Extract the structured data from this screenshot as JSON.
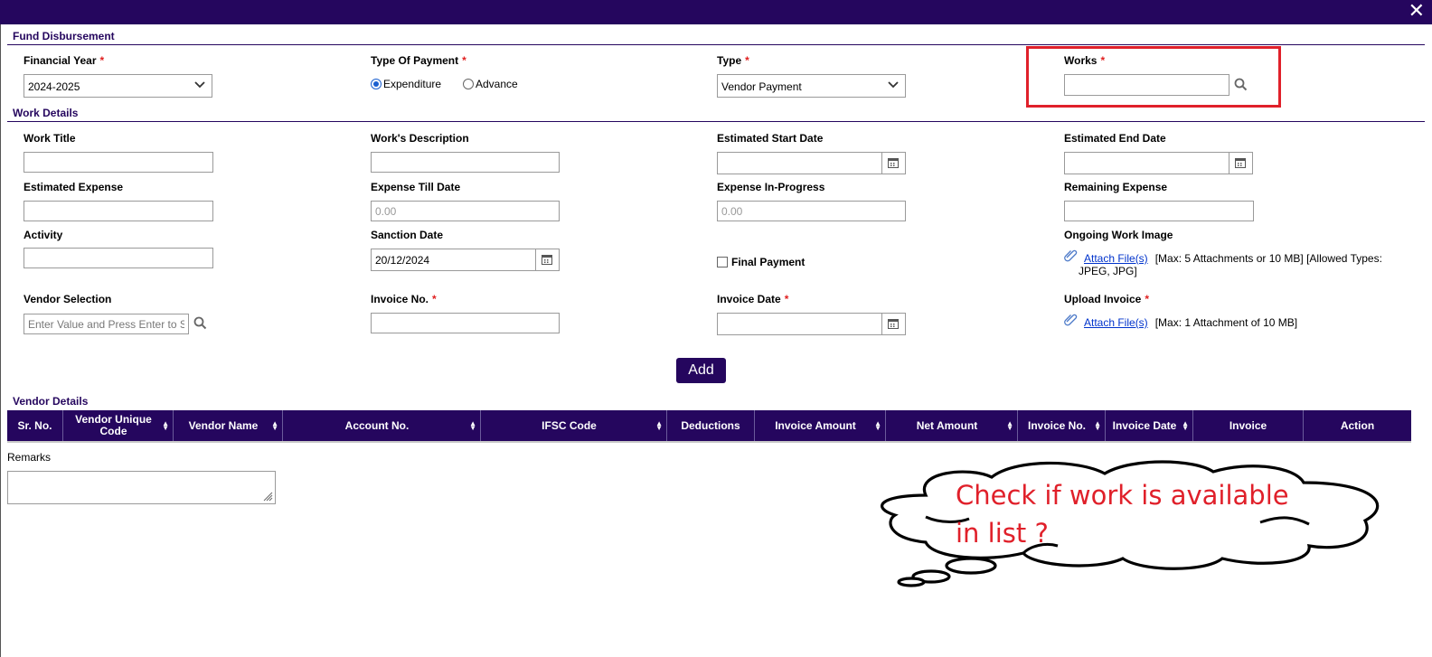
{
  "window": {
    "close_glyph": "✕"
  },
  "sections": {
    "fund": "Fund Disbursement",
    "work": "Work Details",
    "vendor": "Vendor Details"
  },
  "fund": {
    "financial_year_label": "Financial Year",
    "financial_year_value": "2024-2025",
    "type_of_payment_label": "Type Of Payment",
    "payment_options": [
      "Expenditure",
      "Advance"
    ],
    "payment_selected": "Expenditure",
    "type_label": "Type",
    "type_value": "Vendor Payment",
    "works_label": "Works",
    "works_value": ""
  },
  "work": {
    "work_title_label": "Work Title",
    "work_description_label": "Work's Description",
    "est_start_label": "Estimated Start Date",
    "est_end_label": "Estimated End Date",
    "est_expense_label": "Estimated Expense",
    "expense_till_label": "Expense Till Date",
    "expense_till_value": "0.00",
    "expense_inprog_label": "Expense In-Progress",
    "expense_inprog_value": "0.00",
    "remaining_label": "Remaining Expense",
    "activity_label": "Activity",
    "sanction_label": "Sanction Date",
    "sanction_value": "20/12/2024",
    "final_payment_label": "Final Payment",
    "ongoing_image_label": "Ongoing Work Image",
    "attach_link": "Attach File(s)",
    "ongoing_note": "[Max: 5 Attachments or 10 MB] [Allowed Types: JPEG, JPG]",
    "vendor_selection_label": "Vendor Selection",
    "vendor_placeholder": "Enter Value and Press Enter to Search",
    "invoice_no_label": "Invoice No.",
    "invoice_date_label": "Invoice Date",
    "upload_invoice_label": "Upload Invoice",
    "upload_note": "[Max: 1 Attachment of 10 MB]",
    "add_button": "Add"
  },
  "vendor_table": {
    "columns": [
      "Sr. No.",
      "Vendor Unique Code",
      "Vendor Name",
      "Account No.",
      "IFSC Code",
      "Deductions",
      "Invoice Amount",
      "Net Amount",
      "Invoice No.",
      "Invoice Date",
      "Invoice",
      "Action"
    ],
    "sortable": [
      false,
      true,
      true,
      true,
      true,
      false,
      true,
      true,
      true,
      true,
      false,
      false
    ]
  },
  "remarks_label": "Remarks",
  "annotation": {
    "line1": "Check if work is available",
    "line2": "in list ?",
    "color": "#e0202a"
  },
  "colors": {
    "brand": "#25065e",
    "required": "#e02020"
  }
}
